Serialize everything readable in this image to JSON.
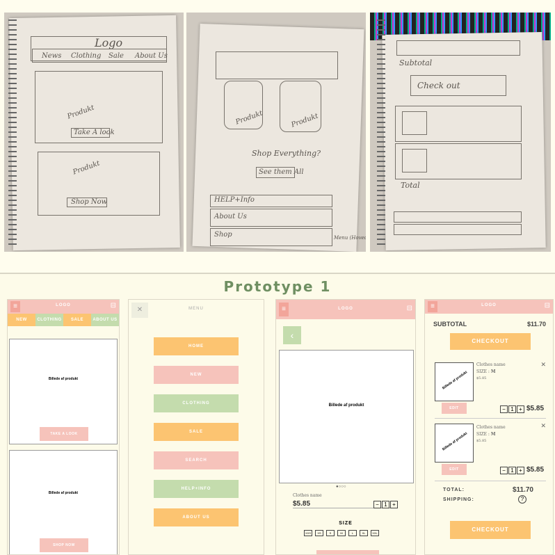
{
  "sketches": {
    "s1": {
      "logo": "Logo",
      "nav": [
        "News",
        "Clothing",
        "Sale",
        "About Us"
      ],
      "card1_label": "Produkt",
      "card1_btn": "Take A look",
      "card2_label": "Produkt",
      "card2_btn": "Shop Now"
    },
    "s2": {
      "label1": "Produkt",
      "label2": "Produkt",
      "question": "Shop Everything?",
      "see_btn": "See them All",
      "rows": [
        "HELP+Info",
        "About Us",
        "Shop"
      ],
      "note": "Menu (Hoved menu)"
    },
    "s3": {
      "subtotal": "Subtotal",
      "checkout": "Check out",
      "total": "Total"
    }
  },
  "prototype": {
    "title": "Prototype 1",
    "screen1": {
      "logo": "LOGO",
      "nav": [
        "NEW",
        "CLOTHING",
        "SALE",
        "ABOUT US"
      ],
      "card1_label": "Billede af produkt",
      "card1_btn": "TAKE A LOOK",
      "card2_label": "Billede af produkt",
      "card2_btn": "SHOP NOW"
    },
    "screen2": {
      "close": "✕",
      "title": "MENU",
      "items": [
        "HOME",
        "NEW",
        "CLOTHING",
        "SALE",
        "SEARCH",
        "HELP+INFO",
        "ABOUT US"
      ]
    },
    "screen3": {
      "logo": "LOGO",
      "back": "‹",
      "image_label": "Billede af produkt",
      "name": "Clothes name",
      "price": "$5.85",
      "qty": [
        "−",
        "1",
        "+"
      ],
      "size_label": "SIZE",
      "sizes": [
        "XXS",
        "XS",
        "S",
        "M",
        "L",
        "XL",
        "XXL"
      ]
    },
    "screen4": {
      "logo": "LOGO",
      "subtotal_label": "SUBTOTAL",
      "subtotal": "$11.70",
      "checkout": "CHECKOUT",
      "items": [
        {
          "image_label": "Billede af produkt",
          "name": "Clothes name",
          "size_label": "SIZE :",
          "size": "M",
          "unit": "$5.85",
          "edit": "EDIT",
          "qty": "1",
          "price": "$5.85"
        },
        {
          "image_label": "Billede af produkt",
          "name": "Clothes name",
          "size_label": "SIZE :",
          "size": "M",
          "unit": "$5.85",
          "edit": "EDIT",
          "qty": "1",
          "price": "$5.85"
        }
      ],
      "total_label": "TOTAL:",
      "total": "$11.70",
      "shipping_label": "SHIPPING:",
      "checkout2": "CHECKOUT"
    }
  }
}
